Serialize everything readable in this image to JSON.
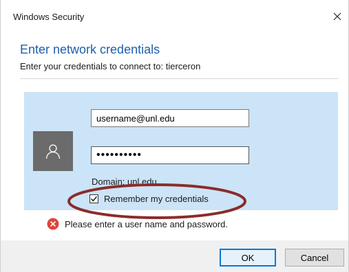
{
  "window": {
    "title": "Windows Security",
    "close_icon": "close-icon"
  },
  "dialog": {
    "heading": "Enter network credentials",
    "subheading": "Enter your credentials to connect to: tierceron"
  },
  "credentials": {
    "avatar_icon": "user-icon",
    "username_value": "username@unl.edu",
    "password_value": "••••••••••",
    "domain_text": "Domain: unl.edu",
    "remember_label": "Remember my credentials",
    "remember_checked": true
  },
  "error": {
    "icon": "error-icon",
    "message": "Please enter a user name and password."
  },
  "buttons": {
    "ok": "OK",
    "cancel": "Cancel"
  },
  "colors": {
    "accent": "#1f5fad",
    "panel_bg": "#cce4f7",
    "annotation": "#8b2c2c",
    "error": "#e0443a"
  }
}
